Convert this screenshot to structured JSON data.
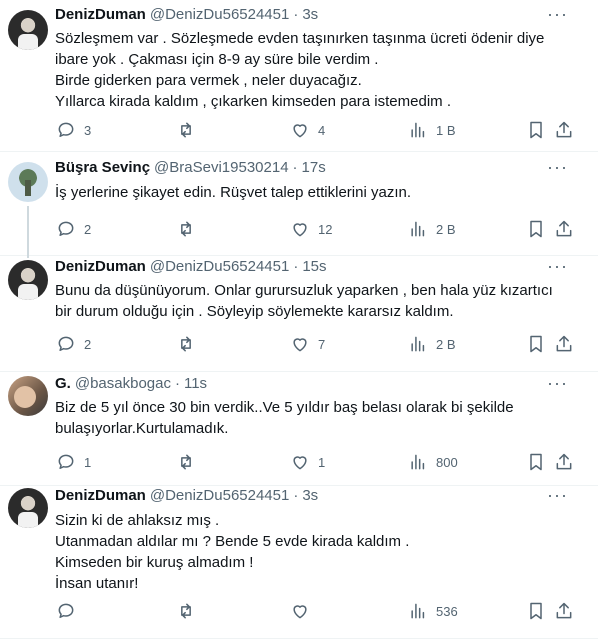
{
  "tweets": [
    {
      "name": "DenizDuman",
      "handle": "@DenizDu56524451",
      "time": "3s",
      "text": "Sözleşmem var . Sözleşmede evden taşınırken taşınma ücreti ödenir diye\nibare yok . Çakması için 8-9 ay süre bile verdim .\nBirde giderken para vermek , neler duyacağız.\n Yıllarca kirada kaldım , çıkarken kimseden para istemedim .",
      "replies": "3",
      "retweets": "",
      "likes": "4",
      "views": "1 B"
    },
    {
      "name": "Büşra Sevinç",
      "handle": "@BraSevi19530214",
      "time": "17s",
      "text": "İş yerlerine şikayet edin. Rüşvet talep ettiklerini yazın.",
      "replies": "2",
      "retweets": "",
      "likes": "12",
      "views": "2 B"
    },
    {
      "name": "DenizDuman",
      "handle": "@DenizDu56524451",
      "time": "15s",
      "text": "Bunu da düşünüyorum. Onlar gurursuzluk yaparken ,  ben hala yüz kızartıcı\nbir durum olduğu için . Söyleyip söylemekte kararsız kaldım.",
      "replies": "2",
      "retweets": "",
      "likes": "7",
      "views": "2 B"
    },
    {
      "name": "G.",
      "handle": "@basakbogac",
      "time": "11s",
      "text": "Biz de 5 yıl önce 30 bin verdik..Ve 5 yıldır baş belası olarak bi şekilde\nbulaşıyorlar.Kurtulamadık.",
      "replies": "1",
      "retweets": "",
      "likes": "1",
      "views": "800"
    },
    {
      "name": "DenizDuman",
      "handle": "@DenizDu56524451",
      "time": "3s",
      "text": "Sizin ki de ahlaksız mış .\nUtanmadan aldılar mı ? Bende 5 evde kirada kaldım .\nKimseden bir kuruş almadım !\nİnsan utanır!",
      "replies": "",
      "retweets": "",
      "likes": "",
      "views": "536"
    }
  ],
  "more_glyph": "···",
  "dot": "·"
}
